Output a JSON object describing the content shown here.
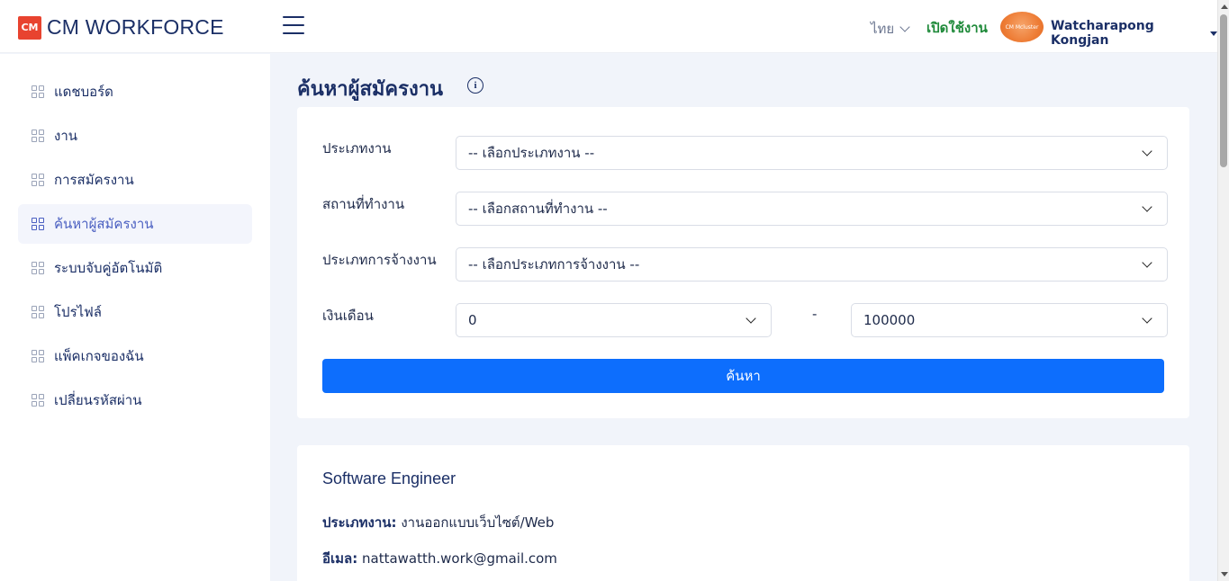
{
  "header": {
    "logo_badge": "CM",
    "logo_text": "CM WORKFORCE",
    "language": "ไทย",
    "open_jobs": "เปิดใช้งาน",
    "avatar_text": "CM Mcluster",
    "username": "Watcharapong Kongjan"
  },
  "sidebar": {
    "items": [
      {
        "label": "แดชบอร์ด"
      },
      {
        "label": "งาน"
      },
      {
        "label": "การสมัครงาน"
      },
      {
        "label": "ค้นหาผู้สมัครงาน"
      },
      {
        "label": "ระบบจับคู่อัตโนมัติ"
      },
      {
        "label": "โปรไฟล์"
      },
      {
        "label": "แพ็คเกจของฉัน"
      },
      {
        "label": "เปลี่ยนรหัสผ่าน"
      }
    ],
    "active_index": 3
  },
  "main": {
    "title": "ค้นหาผู้สมัครงาน",
    "filters": {
      "job_type_label": "ประเภทงาน",
      "job_type_value": "-- เลือกประเภทงาน --",
      "location_label": "สถานที่ทำงาน",
      "location_value": "-- เลือกสถานที่ทำงาน --",
      "employment_label": "ประเภทการจ้างงาน",
      "employment_value": "-- เลือกประเภทการจ้างงาน --",
      "salary_label": "เงินเดือน",
      "salary_min": "0",
      "salary_sep": "-",
      "salary_max": "100000",
      "search_label": "ค้นหา"
    },
    "result": {
      "title": "Software Engineer",
      "job_type_key": "ประเภทงาน:",
      "job_type_val": "งานออกแบบเว็บไซต์/Web",
      "email_key": "อีเมล:",
      "email_val": "nattawatth.work@gmail.com"
    }
  },
  "colors": {
    "primary_button": "#0d6efd",
    "open_jobs": "#1f8a3a",
    "brand_navy": "#1b2f66",
    "logo_red": "#e8432f"
  }
}
